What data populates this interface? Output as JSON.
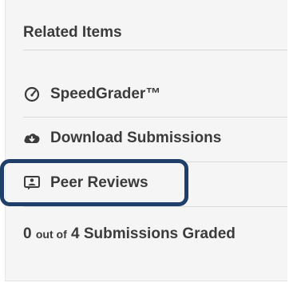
{
  "related": {
    "header": "Related Items",
    "items": [
      {
        "label": "SpeedGrader™",
        "icon": "speedgrader-gauge-icon"
      },
      {
        "label": "Download Submissions",
        "icon": "cloud-download-icon"
      },
      {
        "label": "Peer Reviews",
        "icon": "peer-review-icon"
      }
    ],
    "graded": {
      "count": "0",
      "out_of": "out of",
      "total": "4 Submissions Graded"
    }
  },
  "colors": {
    "highlight_border": "#1f3f6b",
    "panel_bg": "#f5f5f5",
    "text": "#3b3b3b"
  }
}
